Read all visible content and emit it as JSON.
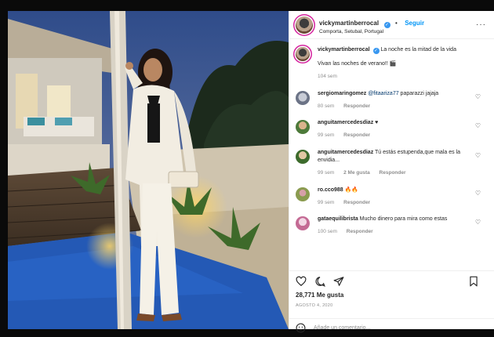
{
  "header": {
    "username": "vickymartinberrocal",
    "follow_label": "Seguir",
    "dot": "•",
    "location": "Comporta, Setubal, Portugal",
    "more": "···"
  },
  "caption": {
    "username": "vickymartinberrocal",
    "text": "La noche es la mitad de la vida",
    "line2": "Vivan las noches de verano!! 🎬",
    "age": "104 sem"
  },
  "comments": [
    {
      "username": "sergiomaringomez",
      "mention": "@fitaariza77",
      "text": " paparazzi jajaja",
      "age": "80 sem",
      "likes": "",
      "reply": "Responder"
    },
    {
      "username": "anguitamercedesdiaz",
      "mention": "",
      "text": " ♥",
      "age": "99 sem",
      "likes": "",
      "reply": "Responder"
    },
    {
      "username": "anguitamercedesdiaz",
      "mention": "",
      "text": " Tú estás estupenda,que mala es la envidia...",
      "age": "99 sem",
      "likes": "2 Me gusta",
      "reply": "Responder"
    },
    {
      "username": "ro.cco988",
      "mention": "",
      "text": " 🔥🔥",
      "age": "99 sem",
      "likes": "",
      "reply": "Responder"
    },
    {
      "username": "gataequilibrista",
      "mention": "",
      "text": " Mucho dinero para mira como estas",
      "age": "100 sem",
      "likes": "",
      "reply": "Responder"
    }
  ],
  "likes_count": "28,771 Me gusta",
  "date": "AGOSTO 4, 2020",
  "comment_box": {
    "placeholder": "Añade un comentario..."
  },
  "icons": [
    "heart-icon",
    "comment-icon",
    "share-icon",
    "bookmark-icon",
    "emoji-icon",
    "verified-badge-icon",
    "more-options-icon"
  ],
  "colors": {
    "accent": "#0095f6",
    "verified": "#3897f0",
    "muted": "#8e8e8e"
  }
}
